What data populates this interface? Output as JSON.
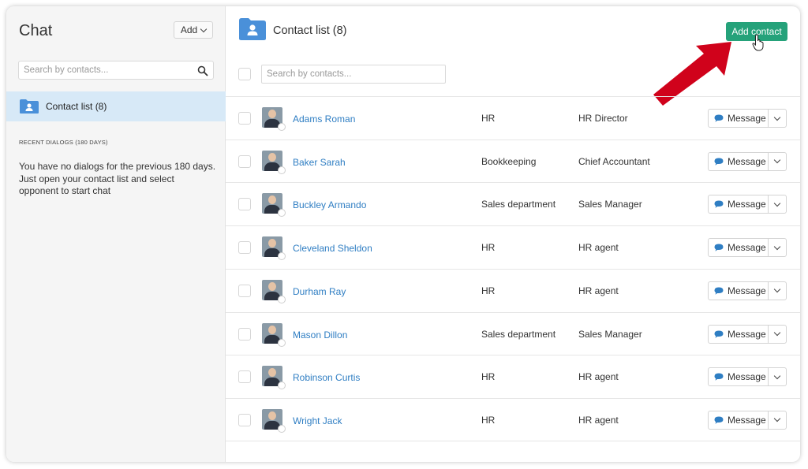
{
  "sidebar": {
    "title": "Chat",
    "add_button": "Add",
    "search_placeholder": "Search by contacts...",
    "contact_list_label": "Contact list (8)",
    "recent_header": "RECENT DIALOGS (180 DAYS)",
    "empty_text": "You have no dialogs for the previous 180 days. Just open your contact list and select opponent to start chat"
  },
  "main": {
    "title": "Contact list (8)",
    "add_contact_button": "Add contact",
    "search_placeholder": "Search by contacts...",
    "message_label": "Message",
    "contacts": [
      {
        "name": "Adams Roman",
        "department": "HR",
        "position": "HR Director"
      },
      {
        "name": "Baker Sarah",
        "department": "Bookkeeping",
        "position": "Chief Accountant"
      },
      {
        "name": "Buckley Armando",
        "department": "Sales department",
        "position": "Sales Manager"
      },
      {
        "name": "Cleveland Sheldon",
        "department": "HR",
        "position": "HR agent"
      },
      {
        "name": "Durham Ray",
        "department": "HR",
        "position": "HR agent"
      },
      {
        "name": "Mason Dillon",
        "department": "Sales department",
        "position": "Sales Manager"
      },
      {
        "name": "Robinson Curtis",
        "department": "HR",
        "position": "HR agent"
      },
      {
        "name": "Wright Jack",
        "department": "HR",
        "position": "HR agent"
      }
    ]
  },
  "colors": {
    "accent_green": "#25a27a",
    "link_blue": "#2f7ec3",
    "folder_blue": "#4a90d9",
    "selected_bg": "#d7e9f7",
    "arrow_red": "#d0021b"
  },
  "icons": [
    "search-icon",
    "folder-icon",
    "chevron-down-icon",
    "chat-bubble-icon",
    "pointer-hand-icon",
    "annotation-arrow"
  ]
}
